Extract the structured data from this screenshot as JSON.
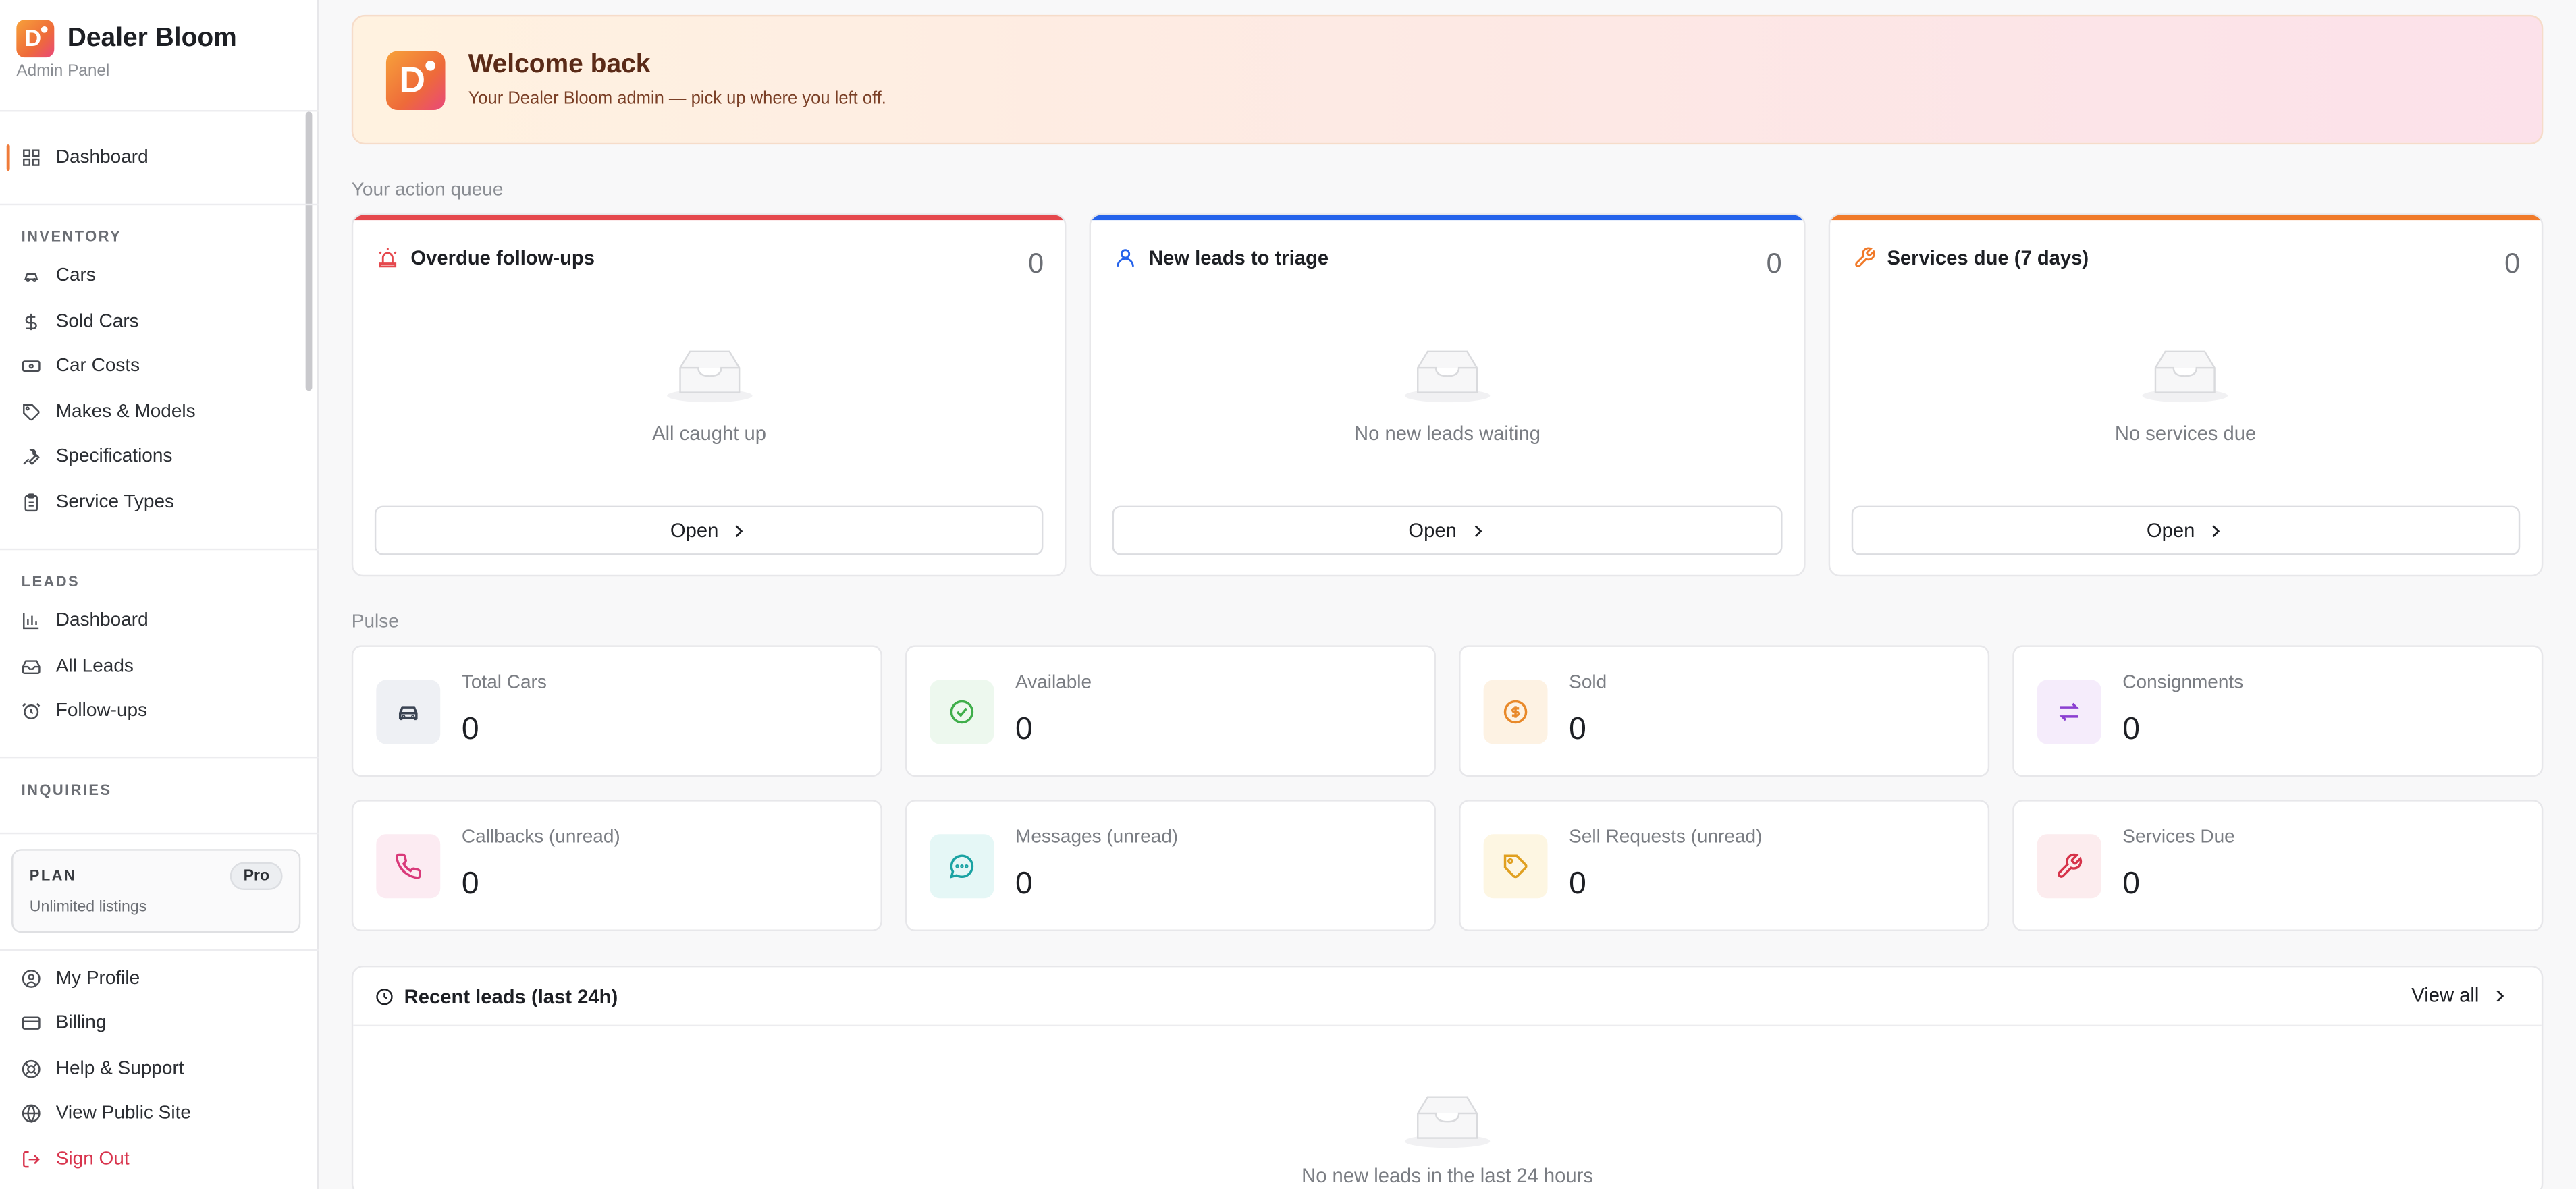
{
  "brand": {
    "name": "Dealer Bloom",
    "subtitle": "Admin Panel",
    "logo_letter": "D"
  },
  "sidebar": {
    "dashboard": "Dashboard",
    "sections": {
      "inventory": "INVENTORY",
      "leads": "LEADS",
      "inquiries": "INQUIRIES"
    },
    "inventory_items": [
      {
        "label": "Cars",
        "icon": "car-icon"
      },
      {
        "label": "Sold Cars",
        "icon": "dollar-icon"
      },
      {
        "label": "Car Costs",
        "icon": "banknote-icon"
      },
      {
        "label": "Makes & Models",
        "icon": "tag-icon"
      },
      {
        "label": "Specifications",
        "icon": "wrench-icon"
      },
      {
        "label": "Service Types",
        "icon": "clipboard-icon"
      }
    ],
    "leads_items": [
      {
        "label": "Dashboard",
        "icon": "bar-chart-icon"
      },
      {
        "label": "All Leads",
        "icon": "inbox-icon"
      },
      {
        "label": "Follow-ups",
        "icon": "alarm-clock-icon"
      }
    ],
    "plan": {
      "label": "PLAN",
      "badge": "Pro",
      "description": "Unlimited listings"
    },
    "bottom_items": [
      {
        "label": "My Profile",
        "icon": "user-circle-icon"
      },
      {
        "label": "Billing",
        "icon": "credit-card-icon"
      },
      {
        "label": "Help & Support",
        "icon": "life-buoy-icon"
      },
      {
        "label": "View Public Site",
        "icon": "globe-icon"
      },
      {
        "label": "Sign Out",
        "icon": "log-out-icon"
      }
    ]
  },
  "welcome": {
    "title": "Welcome back",
    "subtitle": "Your Dealer Bloom admin — pick up where you left off."
  },
  "queue": {
    "label": "Your action queue",
    "cards": [
      {
        "title": "Overdue follow-ups",
        "count": "0",
        "empty": "All caught up",
        "button": "Open",
        "color": "#e5484d",
        "icon": "siren-icon"
      },
      {
        "title": "New leads to triage",
        "count": "0",
        "empty": "No new leads waiting",
        "button": "Open",
        "color": "#2563eb",
        "icon": "user-icon"
      },
      {
        "title": "Services due (7 days)",
        "count": "0",
        "empty": "No services due",
        "button": "Open",
        "color": "#f07a2a",
        "icon": "wrench-icon"
      }
    ]
  },
  "pulse": {
    "label": "Pulse",
    "stats": [
      {
        "label": "Total Cars",
        "value": "0",
        "icon": "car-icon",
        "color": "#3b4453",
        "bg": "#eef0f4"
      },
      {
        "label": "Available",
        "value": "0",
        "icon": "check-circle-icon",
        "color": "#3fae4a",
        "bg": "#edf8ee"
      },
      {
        "label": "Sold",
        "value": "0",
        "icon": "dollar-circle-icon",
        "color": "#e8892a",
        "bg": "#fdf2e3"
      },
      {
        "label": "Consignments",
        "value": "0",
        "icon": "swap-icon",
        "color": "#8b3fd1",
        "bg": "#f5ecfb"
      },
      {
        "label": "Callbacks (unread)",
        "value": "0",
        "icon": "phone-icon",
        "color": "#d93a7a",
        "bg": "#fcebf2"
      },
      {
        "label": "Messages (unread)",
        "value": "0",
        "icon": "message-icon",
        "color": "#1aa3a3",
        "bg": "#e5f7f6"
      },
      {
        "label": "Sell Requests (unread)",
        "value": "0",
        "icon": "tag-icon",
        "color": "#e0a020",
        "bg": "#fdf6e2"
      },
      {
        "label": "Services Due",
        "value": "0",
        "icon": "wrench-icon",
        "color": "#d6334a",
        "bg": "#fcecee"
      }
    ]
  },
  "recent": {
    "title": "Recent leads (last 24h)",
    "view_all": "View all",
    "empty": "No new leads in the last 24 hours"
  }
}
